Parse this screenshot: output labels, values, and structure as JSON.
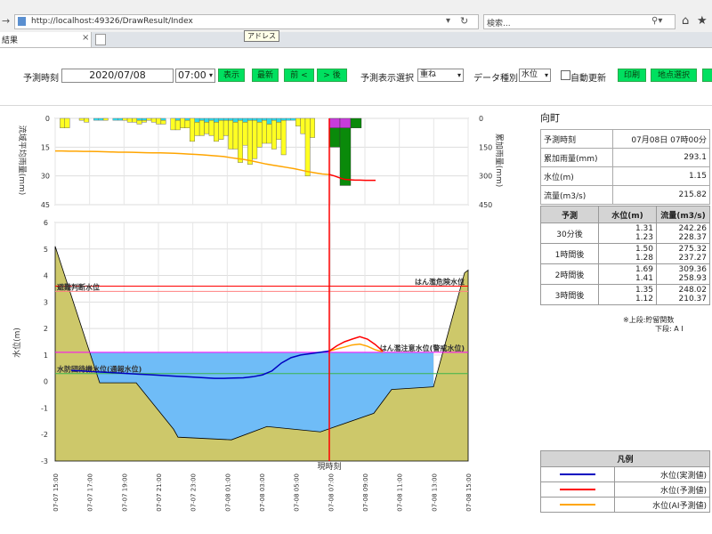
{
  "browser": {
    "url": "http://localhost:49326/DrawResult/Index",
    "url_host": "localhost",
    "search_placeholder": "検索...",
    "tab_title": "結果",
    "tooltip": "アドレス"
  },
  "toolbar": {
    "forecast_time_label": "予測時刻",
    "date_value": "2020/07/08",
    "time_value": "07:00",
    "display_button": "表示",
    "latest_button": "最新",
    "prev_button": "前 <",
    "next_button": "> 後",
    "display_select_label": "予測表示選択",
    "display_select_value": "重ね",
    "data_type_label": "データ種別",
    "data_type_value": "水位",
    "auto_update_label": "自動更新",
    "print_button": "印刷",
    "site_select_button": "地点選択"
  },
  "rain_chart": {
    "left_axis_label": "流域平均雨量(mm)",
    "right_axis_label": "累加雨量(mm)",
    "left_ticks": [
      "0",
      "15",
      "30",
      "45"
    ],
    "right_ticks": [
      "0",
      "150",
      "300",
      "450"
    ],
    "bars": [
      0,
      5,
      5,
      0,
      0,
      1,
      2,
      0,
      0,
      0,
      1,
      0,
      0,
      0,
      1,
      2,
      2,
      2,
      1,
      1,
      2,
      3,
      2,
      0,
      6,
      5,
      5,
      4,
      12,
      7,
      8,
      6,
      8,
      10,
      10,
      8,
      15,
      14,
      22,
      12,
      23,
      20,
      13,
      12,
      10,
      15,
      9,
      18,
      0,
      0,
      4,
      8,
      30,
      10,
      0,
      0,
      0
    ],
    "bars_cyan": [
      0,
      0,
      0,
      0,
      0,
      0,
      0,
      0,
      1,
      1,
      0,
      0,
      1,
      1,
      0,
      0,
      0,
      1,
      1,
      0,
      0,
      0,
      1,
      0,
      0,
      1,
      0,
      1,
      0,
      2,
      1,
      2,
      1,
      2,
      1,
      1,
      1,
      2,
      1,
      2,
      1,
      1,
      2,
      1,
      3,
      1,
      2,
      1,
      1,
      1,
      0,
      0,
      0,
      0,
      0,
      0,
      0
    ],
    "forecast_bars_green": [
      10,
      30,
      5
    ],
    "forecast_bars_magenta": [
      5,
      5,
      0
    ],
    "cumulative": [
      170,
      170,
      171,
      171,
      172,
      172,
      173,
      174,
      175,
      176,
      176,
      177,
      178,
      179,
      180,
      180,
      181,
      182,
      184,
      186,
      188,
      190,
      193,
      196,
      199,
      205,
      210,
      215,
      222,
      230,
      238,
      244,
      250,
      256,
      262,
      270,
      278,
      284,
      290,
      293
    ],
    "cumulative_forecast": [
      293,
      300,
      310,
      318,
      320,
      322,
      322,
      323,
      323,
      323
    ]
  },
  "water_chart": {
    "y_axis_label": "水位(m)",
    "y_ticks": [
      "6",
      "5",
      "4",
      "3",
      "2",
      "1",
      "0",
      "-1",
      "-2",
      "-3"
    ],
    "x_ticks": [
      "07-07 15:00",
      "07-07 17:00",
      "07-07 19:00",
      "07-07 21:00",
      "07-07 23:00",
      "07-08 01:00",
      "07-08 03:00",
      "07-08 05:00",
      "07-08 07:00",
      "07-08 09:00",
      "07-08 11:00",
      "07-08 13:00",
      "07-08 15:00"
    ],
    "now_label": "現時刻",
    "levels": [
      {
        "name": "はん濫危険水位",
        "value": 3.6,
        "color": "#ff0000",
        "side": "right"
      },
      {
        "name": "避難判断水位",
        "value": 3.4,
        "color": "#ff8080",
        "side": "left"
      },
      {
        "name": "はん濫注意水位(警戒水位)",
        "value": 1.1,
        "color": "#ff00ff",
        "side": "right"
      },
      {
        "name": "水防団待機水位(通報水位)",
        "value": 0.3,
        "color": "#3cb44b",
        "side": "left"
      }
    ],
    "observed": [
      0.42,
      0.4,
      0.38,
      0.36,
      0.34,
      0.32,
      0.3,
      0.28,
      0.26,
      0.24,
      0.22,
      0.2,
      0.18,
      0.16,
      0.14,
      0.12,
      0.12,
      0.13,
      0.14,
      0.18,
      0.25,
      0.4,
      0.7,
      0.9,
      1.0,
      1.05,
      1.1,
      1.15
    ],
    "forecast": [
      1.15,
      1.35,
      1.5,
      1.6,
      1.69,
      1.6,
      1.4,
      1.15
    ],
    "forecast_ai": [
      1.15,
      1.23,
      1.3,
      1.38,
      1.41,
      1.33,
      1.2,
      1.12
    ]
  },
  "site": {
    "name": "向町",
    "info": [
      {
        "label": "予測時刻",
        "value": "07月08日 07時00分"
      },
      {
        "label": "累加雨量(mm)",
        "value": "293.1"
      },
      {
        "label": "水位(m)",
        "value": "1.15"
      },
      {
        "label": "流量(m3/s)",
        "value": "215.82"
      }
    ]
  },
  "prediction_table": {
    "headers": [
      "予測",
      "水位(m)",
      "流量(m3/s)"
    ],
    "rows": [
      {
        "label": "30分後",
        "level_upper": "1.31",
        "level_lower": "1.23",
        "flow_upper": "242.26",
        "flow_lower": "228.37"
      },
      {
        "label": "1時間後",
        "level_upper": "1.50",
        "level_lower": "1.28",
        "flow_upper": "275.32",
        "flow_lower": "237.27"
      },
      {
        "label": "2時間後",
        "level_upper": "1.69",
        "level_lower": "1.41",
        "flow_upper": "309.36",
        "flow_lower": "258.93"
      },
      {
        "label": "3時間後",
        "level_upper": "1.35",
        "level_lower": "1.12",
        "flow_upper": "248.02",
        "flow_lower": "210.37"
      }
    ],
    "note_upper": "※上段:貯留関数",
    "note_lower": "下段: A I"
  },
  "legend": {
    "title": "凡例",
    "items": [
      {
        "label": "水位(実測値)",
        "color": "#0000c0"
      },
      {
        "label": "水位(予測値)",
        "color": "#ff0000"
      },
      {
        "label": "水位(AI予測値)",
        "color": "#ffa500"
      }
    ]
  }
}
